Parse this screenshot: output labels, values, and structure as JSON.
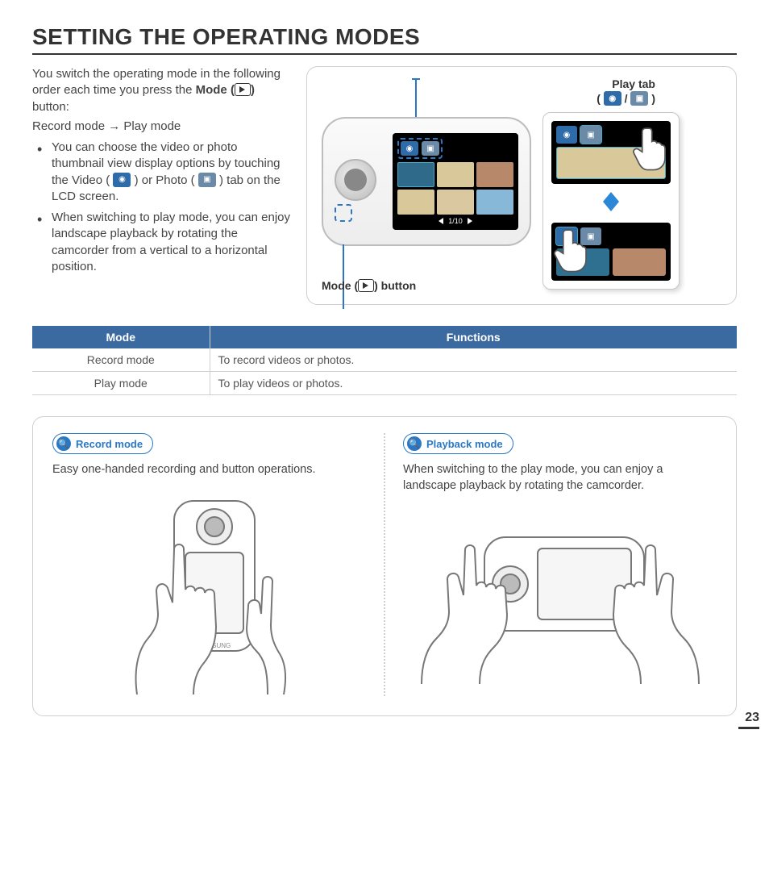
{
  "page": {
    "title": "SETTING THE OPERATING MODES",
    "number": "23"
  },
  "intro": {
    "p1_a": "You switch the operating mode in the following order each time you press the ",
    "p1_b": "Mode (",
    "p1_c": ") ",
    "p1_d": "button:",
    "p2": "Record mode → Play mode",
    "bullet1_a": "You can choose the video or photo thumbnail view display options by touching the Video (",
    "bullet1_b": ") or Photo (",
    "bullet1_c": ") tab on the LCD screen.",
    "bullet2": "When switching to play mode, you can enjoy landscape playback by rotating the camcorder from a vertical to a horizontal position."
  },
  "illus": {
    "play_tab_label": "Play tab",
    "play_tab_paren_open": "(",
    "play_tab_sep": " / ",
    "play_tab_paren_close": ")",
    "mode_button_a": "Mode (",
    "mode_button_b": ") button",
    "counter": "1/10"
  },
  "table": {
    "head_mode": "Mode",
    "head_func": "Functions",
    "rows": [
      {
        "mode": "Record mode",
        "func": "To record videos or photos."
      },
      {
        "mode": "Play mode",
        "func": "To play videos or photos."
      }
    ]
  },
  "features": {
    "record": {
      "pill": "Record mode",
      "text": "Easy one-handed recording and button operations."
    },
    "playback": {
      "pill": "Playback mode",
      "text": "When switching to the play mode, you can enjoy a landscape playback by rotating the camcorder."
    }
  }
}
